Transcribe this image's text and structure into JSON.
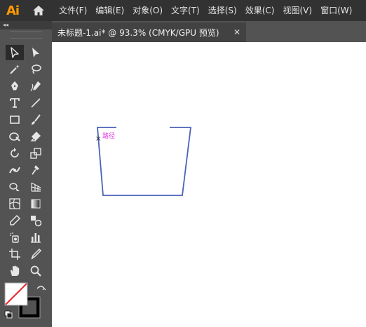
{
  "app": {
    "logo": "Ai"
  },
  "menu": {
    "items": [
      "文件(F)",
      "编辑(E)",
      "对象(O)",
      "文字(T)",
      "选择(S)",
      "效果(C)",
      "视图(V)",
      "窗口(W)"
    ]
  },
  "toolbar": {
    "collapse_glyph": "◂◂"
  },
  "document": {
    "tab_title": "未标题-1.ai* @ 93.3% (CMYK/GPU 预览)",
    "close_glyph": "✕"
  },
  "canvas": {
    "path_label": "路径"
  },
  "colors": {
    "accent_selected_path": "#4a62b8",
    "smart_guide_label": "#e23ce6",
    "logo": "#ff9a00"
  },
  "icons": {
    "tools": [
      "selection-tool-icon",
      "direct-selection-tool-icon",
      "magic-wand-tool-icon",
      "lasso-tool-icon",
      "pen-tool-icon",
      "curvature-tool-icon",
      "type-tool-icon",
      "line-segment-tool-icon",
      "rectangle-tool-icon",
      "paintbrush-tool-icon",
      "shaper-tool-icon",
      "eraser-tool-icon",
      "rotate-tool-icon",
      "scale-tool-icon",
      "width-tool-icon",
      "puppet-warp-tool-icon",
      "shape-builder-tool-icon",
      "perspective-grid-tool-icon",
      "mesh-tool-icon",
      "gradient-tool-icon",
      "eyedropper-tool-icon",
      "blend-tool-icon",
      "symbol-sprayer-tool-icon",
      "column-graph-tool-icon",
      "artboard-tool-icon",
      "slice-tool-icon",
      "hand-tool-icon",
      "zoom-tool-icon"
    ]
  }
}
